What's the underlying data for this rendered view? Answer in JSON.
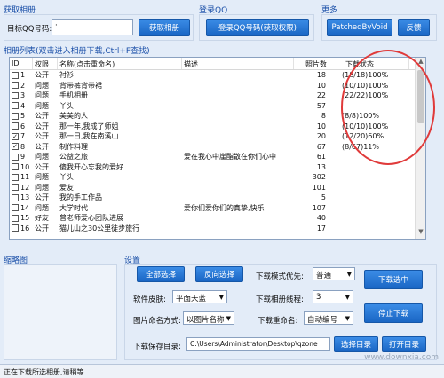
{
  "get_album": {
    "title": "获取相册",
    "qq_label": "目标QQ号码:",
    "qq_value": "·",
    "button": "获取相册"
  },
  "login": {
    "title": "登录QQ",
    "button": "登录QQ号码(获取权限)"
  },
  "more": {
    "title": "更多",
    "patched_button": "PatchedByVoid",
    "feedback_button": "反馈"
  },
  "list": {
    "title": "相册列表(双击进入相册下载,Ctrl+F查找)",
    "headers": {
      "id": "ID",
      "perm": "权限",
      "name": "名称(点击重命名)",
      "desc": "描述",
      "count": "照片数",
      "status": "下载状态"
    },
    "rows": [
      {
        "id": "1",
        "checked": false,
        "perm": "公开",
        "name": "衬衫",
        "desc": "",
        "count": "18",
        "status": "(18/18)100%"
      },
      {
        "id": "2",
        "checked": false,
        "perm": "问题",
        "name": "背带裤背带裙",
        "desc": "",
        "count": "10",
        "status": "(10/10)100%"
      },
      {
        "id": "3",
        "checked": false,
        "perm": "问题",
        "name": "手机相册",
        "desc": "",
        "count": "22",
        "status": "(22/22)100%"
      },
      {
        "id": "4",
        "checked": false,
        "perm": "问题",
        "name": "丫头",
        "desc": "",
        "count": "57",
        "status": ""
      },
      {
        "id": "5",
        "checked": false,
        "perm": "公开",
        "name": "美美的人",
        "desc": "",
        "count": "8",
        "status": "(8/8)100%"
      },
      {
        "id": "6",
        "checked": false,
        "perm": "公开",
        "name": "那一年,我成了师姐",
        "desc": "",
        "count": "10",
        "status": "(10/10)100%"
      },
      {
        "id": "7",
        "checked": true,
        "perm": "公开",
        "name": "那一日,我在南溪山",
        "desc": "",
        "count": "20",
        "status": "(12/20)60%"
      },
      {
        "id": "8",
        "checked": true,
        "perm": "公开",
        "name": "制作料理",
        "desc": "",
        "count": "67",
        "status": "(8/67)11%"
      },
      {
        "id": "9",
        "checked": false,
        "perm": "问题",
        "name": "公益之旅",
        "desc": "爱在我心中崖酯散在你们心中",
        "count": "61",
        "status": ""
      },
      {
        "id": "10",
        "checked": false,
        "perm": "公开",
        "name": "傻我开心忘我的爱好",
        "desc": "",
        "count": "13",
        "status": ""
      },
      {
        "id": "11",
        "checked": false,
        "perm": "问题",
        "name": "丫头",
        "desc": "",
        "count": "302",
        "status": ""
      },
      {
        "id": "12",
        "checked": false,
        "perm": "问题",
        "name": "爱友",
        "desc": "",
        "count": "101",
        "status": ""
      },
      {
        "id": "13",
        "checked": false,
        "perm": "公开",
        "name": "我的手工作品",
        "desc": "",
        "count": "5",
        "status": ""
      },
      {
        "id": "14",
        "checked": false,
        "perm": "问题",
        "name": "大学时代",
        "desc": "爱你们爱你们的真挚,快乐",
        "count": "107",
        "status": ""
      },
      {
        "id": "15",
        "checked": false,
        "perm": "好友",
        "name": "曾老师爱心团队进展",
        "desc": "",
        "count": "40",
        "status": ""
      },
      {
        "id": "16",
        "checked": false,
        "perm": "公开",
        "name": "猫儿山之30公里徒步旅行",
        "desc": "",
        "count": "17",
        "status": ""
      }
    ]
  },
  "thumbnail": {
    "title": "缩略图"
  },
  "settings": {
    "title": "设置",
    "select_all": "全部选择",
    "invert_select": "反向选择",
    "skin_label": "软件皮肤:",
    "skin_value": "平面天蓝",
    "naming_label": "图片命名方式:",
    "naming_value": "以图片名称",
    "mode_label": "下载模式优先:",
    "mode_value": "普通",
    "threads_label": "下载相册线程:",
    "threads_value": "3",
    "rename_label": "下载重命名:",
    "rename_value": "自动编号",
    "dir_label": "下载保存目录:",
    "dir_value": "C:\\Users\\Administrator\\Desktop\\qzone",
    "download_button": "下载选中",
    "stop_button": "停止下载",
    "choose_dir_button": "选择目录",
    "open_dir_button": "打开目录"
  },
  "status_bar": {
    "text": "正在下载所选相册,请稍等..."
  },
  "watermark": "www.downxia.com",
  "colors": {
    "accent": "#1a66c4",
    "highlight_oval": "#e03a3a"
  }
}
